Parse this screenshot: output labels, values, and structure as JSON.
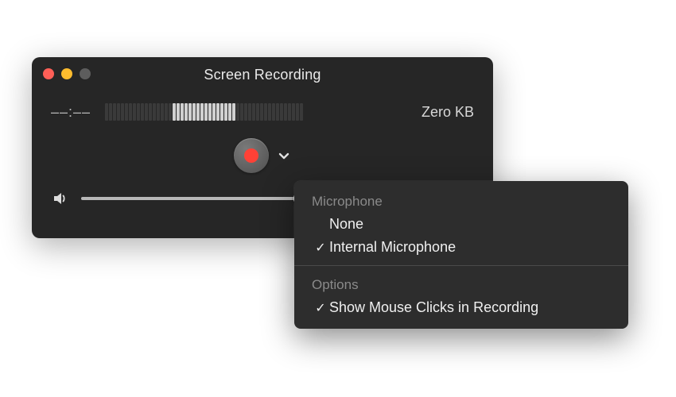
{
  "window": {
    "title": "Screen Recording",
    "timecode": "––:––",
    "filesize": "Zero KB",
    "level_meter": {
      "total_bars": 50,
      "lit_start": 17,
      "lit_end": 33
    },
    "volume": {
      "percent": 56
    }
  },
  "dropdown": {
    "sections": {
      "microphone": {
        "header": "Microphone",
        "items": [
          {
            "label": "None",
            "checked": false
          },
          {
            "label": "Internal Microphone",
            "checked": true
          }
        ]
      },
      "options": {
        "header": "Options",
        "items": [
          {
            "label": "Show Mouse Clicks in Recording",
            "checked": true
          }
        ]
      }
    }
  }
}
